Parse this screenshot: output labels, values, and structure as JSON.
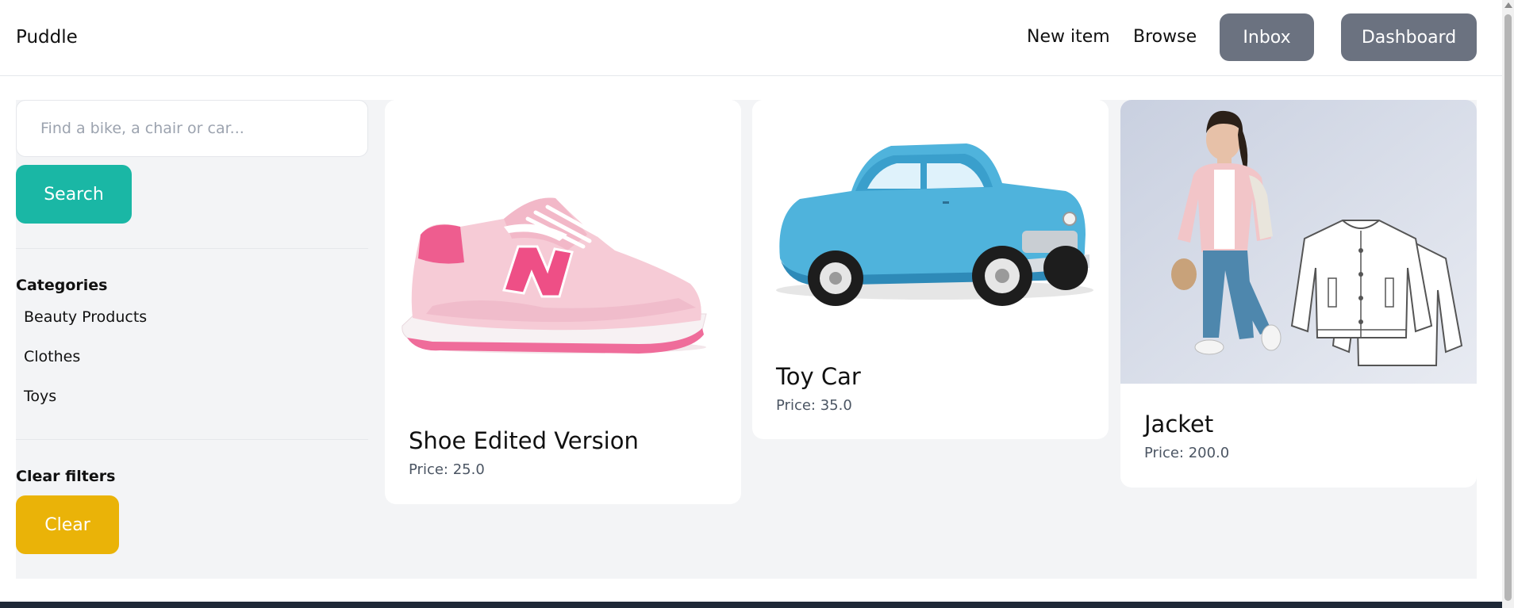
{
  "header": {
    "brand": "Puddle",
    "nav": {
      "new_item": "New item",
      "browse": "Browse",
      "inbox": "Inbox",
      "dashboard": "Dashboard"
    }
  },
  "sidebar": {
    "search": {
      "placeholder": "Find a bike, a chair or car...",
      "value": "",
      "button_label": "Search"
    },
    "categories_heading": "Categories",
    "categories": [
      {
        "label": "Beauty Products"
      },
      {
        "label": "Clothes"
      },
      {
        "label": "Toys"
      }
    ],
    "clear_heading": "Clear filters",
    "clear_button_label": "Clear"
  },
  "items": [
    {
      "title": "Shoe Edited Version",
      "price": "Price: 25.0"
    },
    {
      "title": "Toy Car",
      "price": "Price: 35.0"
    },
    {
      "title": "Jacket",
      "price": "Price: 200.0"
    }
  ],
  "colors": {
    "search_button": "#1ab7a5",
    "clear_button": "#eab308",
    "nav_button": "#6b7280",
    "panel_background": "#f3f4f6"
  }
}
